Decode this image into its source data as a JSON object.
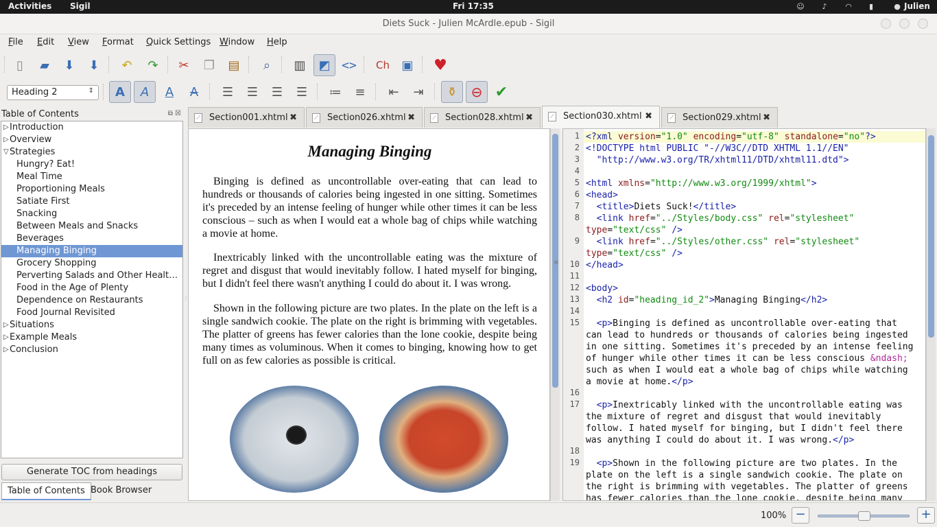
{
  "system_bar": {
    "activities": "Activities",
    "app_name": "Sigil",
    "clock": "Fri 17:35",
    "user": "Julien"
  },
  "window": {
    "title": "Diets Suck - Julien McArdle.epub - Sigil"
  },
  "menu": [
    "File",
    "Edit",
    "View",
    "Format",
    "Quick Settings",
    "Window",
    "Help"
  ],
  "toolbar": {
    "heading_select": "Heading 2"
  },
  "toc": {
    "title": "Table of Contents",
    "items": [
      {
        "label": "Introduction",
        "level": 0,
        "expander": "collapsed"
      },
      {
        "label": "Overview",
        "level": 0,
        "expander": "collapsed"
      },
      {
        "label": "Strategies",
        "level": 0,
        "expander": "expanded"
      },
      {
        "label": "Hungry? Eat!",
        "level": 1
      },
      {
        "label": "Meal Time",
        "level": 1
      },
      {
        "label": "Proportioning Meals",
        "level": 1
      },
      {
        "label": "Satiate First",
        "level": 1
      },
      {
        "label": "Snacking",
        "level": 1
      },
      {
        "label": "Between Meals and Snacks",
        "level": 1
      },
      {
        "label": "Beverages",
        "level": 1
      },
      {
        "label": "Managing Binging",
        "level": 1,
        "selected": true
      },
      {
        "label": "Grocery Shopping",
        "level": 1
      },
      {
        "label": "Perverting Salads and Other Healthy Foods",
        "level": 1
      },
      {
        "label": "Food in the Age of Plenty",
        "level": 1
      },
      {
        "label": "Dependence on Restaurants",
        "level": 1
      },
      {
        "label": "Food Journal Revisited",
        "level": 1
      },
      {
        "label": "Situations",
        "level": 0,
        "expander": "collapsed"
      },
      {
        "label": "Example Meals",
        "level": 0,
        "expander": "collapsed"
      },
      {
        "label": "Conclusion",
        "level": 0,
        "expander": "collapsed"
      }
    ],
    "generate_button": "Generate TOC from headings",
    "bottom_tabs": [
      "Table of Contents",
      "Book Browser"
    ]
  },
  "tabs": [
    {
      "label": "Section001.xhtml",
      "active": false
    },
    {
      "label": "Section026.xhtml",
      "active": false
    },
    {
      "label": "Section028.xhtml",
      "active": false
    },
    {
      "label": "Section030.xhtml",
      "active": true
    },
    {
      "label": "Section029.xhtml",
      "active": false
    }
  ],
  "book_view": {
    "heading": "Managing Binging",
    "paragraphs": [
      "Binging is defined as uncontrollable over-eating that can lead to hundreds or thousands of calories being ingested in one sitting. Sometimes it's preceded by an intense feeling of hunger while other times it can be less conscious – such as when I would eat a whole bag of chips while watching a movie at home.",
      "Inextricably linked with the uncontrollable eating was the mixture of regret and disgust that would inevitably follow. I hated myself for binging, but I didn't feel there wasn't anything I could do about it. I was wrong.",
      "Shown in the following picture are two plates. In the plate on the left is a single sandwich cookie. The plate on the right is brimming with vegetables. The platter of greens has fewer calories than the lone cookie, despite being many times as voluminous. When it comes to binging, knowing how to get full on as few calories as possible is critical."
    ]
  },
  "code_view": {
    "lines": [
      {
        "n": "1",
        "html": "<span class='tg'>&lt;?xml</span> <span class='at'>version</span>=<span class='av'>\"1.0\"</span> <span class='at'>encoding</span>=<span class='av'>\"utf-8\"</span> <span class='at'>standalone</span>=<span class='av'>\"no\"</span><span class='tg'>?&gt;</span>"
      },
      {
        "n": "2",
        "html": "<span class='tg'>&lt;!DOCTYPE html PUBLIC \"-//W3C//DTD XHTML 1.1//EN\"</span>"
      },
      {
        "n": "3",
        "html": "  <span class='tg'>\"http://www.w3.org/TR/xhtml11/DTD/xhtml11.dtd\"&gt;</span>"
      },
      {
        "n": "4",
        "html": ""
      },
      {
        "n": "5",
        "html": "<span class='tg'>&lt;html</span> <span class='at'>xmlns</span>=<span class='av'>\"http://www.w3.org/1999/xhtml\"</span><span class='tg'>&gt;</span>"
      },
      {
        "n": "6",
        "html": "<span class='tg'>&lt;head&gt;</span>"
      },
      {
        "n": "7",
        "html": "  <span class='tg'>&lt;title&gt;</span>Diets Suck!<span class='tg'>&lt;/title&gt;</span>"
      },
      {
        "n": "8",
        "html": "  <span class='tg'>&lt;link</span> <span class='at'>href</span>=<span class='av'>\"../Styles/body.css\"</span> <span class='at'>rel</span>=<span class='av'>\"stylesheet\"</span>\n<span class='at'>type</span>=<span class='av'>\"text/css\"</span> <span class='tg'>/&gt;</span>"
      },
      {
        "n": "9",
        "html": "  <span class='tg'>&lt;link</span> <span class='at'>href</span>=<span class='av'>\"../Styles/other.css\"</span> <span class='at'>rel</span>=<span class='av'>\"stylesheet\"</span>\n<span class='at'>type</span>=<span class='av'>\"text/css\"</span> <span class='tg'>/&gt;</span>"
      },
      {
        "n": "10",
        "html": "<span class='tg'>&lt;/head&gt;</span>"
      },
      {
        "n": "11",
        "html": ""
      },
      {
        "n": "12",
        "html": "<span class='tg'>&lt;body&gt;</span>"
      },
      {
        "n": "13",
        "html": "  <span class='tg'>&lt;h2</span> <span class='at'>id</span>=<span class='av'>\"heading_id_2\"</span><span class='tg'>&gt;</span>Managing Binging<span class='tg'>&lt;/h2&gt;</span>"
      },
      {
        "n": "14",
        "html": ""
      },
      {
        "n": "15",
        "html": "  <span class='tg'>&lt;p&gt;</span>Binging is defined as uncontrollable over-eating that\ncan lead to hundreds or thousands of calories being ingested\nin one sitting. Sometimes it's preceded by an intense feeling\nof hunger while other times it can be less conscious <span class='ent'>&amp;ndash;</span>\nsuch as when I would eat a whole bag of chips while watching\na movie at home.<span class='tg'>&lt;/p&gt;</span>"
      },
      {
        "n": "16",
        "html": ""
      },
      {
        "n": "17",
        "html": "  <span class='tg'>&lt;p&gt;</span>Inextricably linked with the uncontrollable eating was\nthe mixture of regret and disgust that would inevitably\nfollow. I hated myself for binging, but I didn't feel there\nwas anything I could do about it. I was wrong.<span class='tg'>&lt;/p&gt;</span>"
      },
      {
        "n": "18",
        "html": ""
      },
      {
        "n": "19",
        "html": "  <span class='tg'>&lt;p&gt;</span>Shown in the following picture are two plates. In the\nplate on the left is a single sandwich cookie. The plate on\nthe right is brimming with vegetables. The platter of greens\nhas fewer calories than the lone cookie, despite being many"
      }
    ]
  },
  "status": {
    "zoom": "100%"
  },
  "colors": {
    "selection": "#6f97d3",
    "tag": "#1a22a8",
    "attr_value": "#108a10"
  }
}
